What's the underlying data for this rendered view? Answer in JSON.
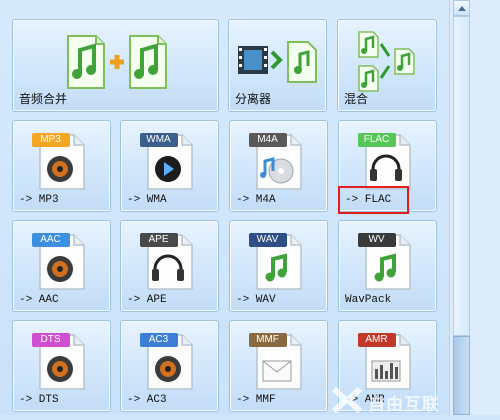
{
  "tools": [
    {
      "label": "音频合并",
      "icon": "audio-merge-icon"
    },
    {
      "label": "分离器",
      "icon": "splitter-icon"
    },
    {
      "label": "混合",
      "icon": "mix-icon"
    }
  ],
  "formats": [
    {
      "badge": "MP3",
      "label": "-> MP3",
      "badge_color": "#f5a623",
      "icon": "speaker-icon"
    },
    {
      "badge": "WMA",
      "label": "-> WMA",
      "badge_color": "#3a5f8a",
      "icon": "windows-media-icon"
    },
    {
      "badge": "M4A",
      "label": "-> M4A",
      "badge_color": "#5a5a5a",
      "icon": "cd-music-icon"
    },
    {
      "badge": "FLAC",
      "label": "-> FLAC",
      "badge_color": "#58c558",
      "icon": "headphones-icon"
    },
    {
      "badge": "AAC",
      "label": "-> AAC",
      "badge_color": "#3d8fe0",
      "icon": "speaker-icon"
    },
    {
      "badge": "APE",
      "label": "-> APE",
      "badge_color": "#4a4a4a",
      "icon": "headphones-icon"
    },
    {
      "badge": "WAV",
      "label": "-> WAV",
      "badge_color": "#2e4e86",
      "icon": "music-note-icon"
    },
    {
      "badge": "WV",
      "label": "WavPack",
      "badge_color": "#3a3a3a",
      "icon": "music-note-icon"
    },
    {
      "badge": "DTS",
      "label": "-> DTS",
      "badge_color": "#d04fd0",
      "icon": "speaker-icon"
    },
    {
      "badge": "AC3",
      "label": "-> AC3",
      "badge_color": "#3d7fd6",
      "icon": "speaker-icon"
    },
    {
      "badge": "MMF",
      "label": "-> MMF",
      "badge_color": "#8a6a40",
      "icon": "envelope-icon"
    },
    {
      "badge": "AMR",
      "label": "-> AMR",
      "badge_color": "#c0392b",
      "icon": "equalizer-icon"
    }
  ],
  "watermark": "自由互联"
}
